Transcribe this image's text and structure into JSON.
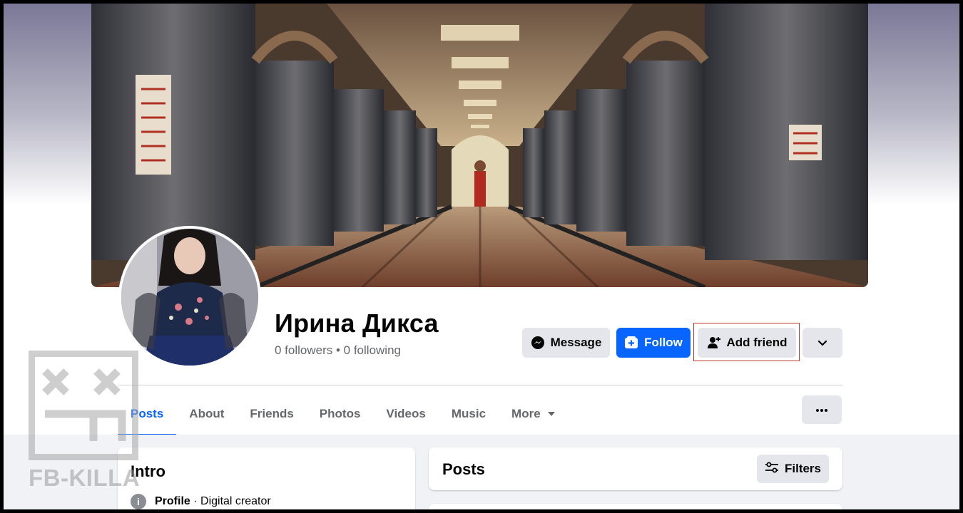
{
  "profile": {
    "name": "Ирина Дикса",
    "stats": "0 followers • 0 following"
  },
  "actions": {
    "message": "Message",
    "follow": "Follow",
    "add_friend": "Add friend"
  },
  "tabs": [
    {
      "label": "Posts",
      "active": true
    },
    {
      "label": "About"
    },
    {
      "label": "Friends"
    },
    {
      "label": "Photos"
    },
    {
      "label": "Videos"
    },
    {
      "label": "Music"
    },
    {
      "label": "More"
    }
  ],
  "intro": {
    "title": "Intro",
    "profile_label": "Profile",
    "profile_value": " · Digital creator"
  },
  "posts": {
    "title": "Posts",
    "filters_label": "Filters"
  },
  "watermark": {
    "text": "FB-KILLA"
  },
  "colors": {
    "accent": "#0866ff",
    "highlight": "#c0392b"
  },
  "icons": {
    "message": "messenger-icon",
    "follow": "follow-plus-icon",
    "add_friend": "add-person-icon",
    "dropdown": "chevron-down-icon",
    "more_options": "ellipsis-icon",
    "filters": "sliders-icon",
    "info": "info-icon"
  }
}
